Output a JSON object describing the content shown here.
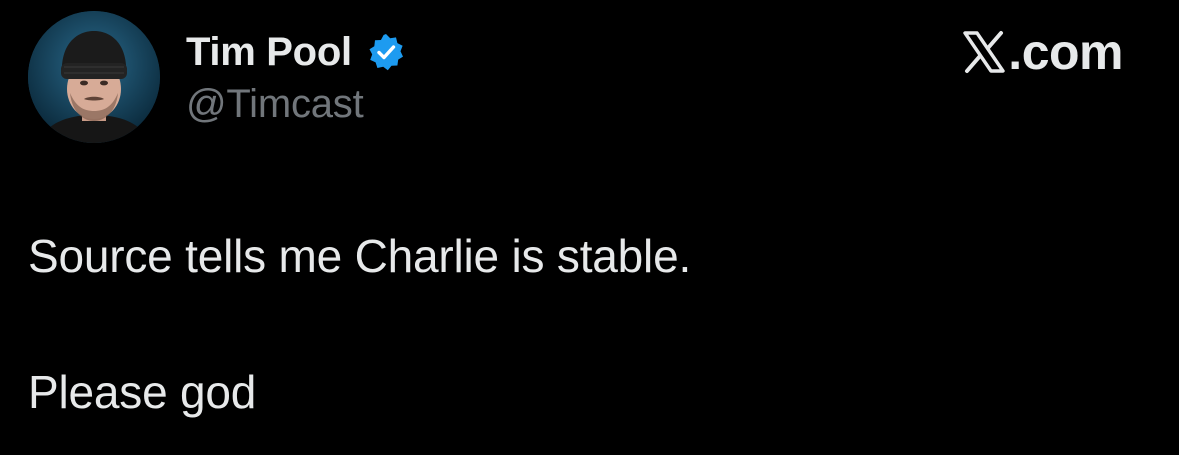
{
  "author": {
    "display_name": "Tim Pool",
    "handle": "@Timcast",
    "verified": true,
    "avatar_icon": "profile-photo"
  },
  "brand": {
    "logo_icon": "x-logo-icon",
    "text": ".com"
  },
  "tweet": {
    "paragraphs": [
      "Source tells me Charlie is stable.",
      "Please god"
    ]
  },
  "colors": {
    "background": "#000000",
    "text_primary": "#e7e9ea",
    "text_secondary": "#71767b",
    "verified_badge": "#1d9bf0"
  }
}
